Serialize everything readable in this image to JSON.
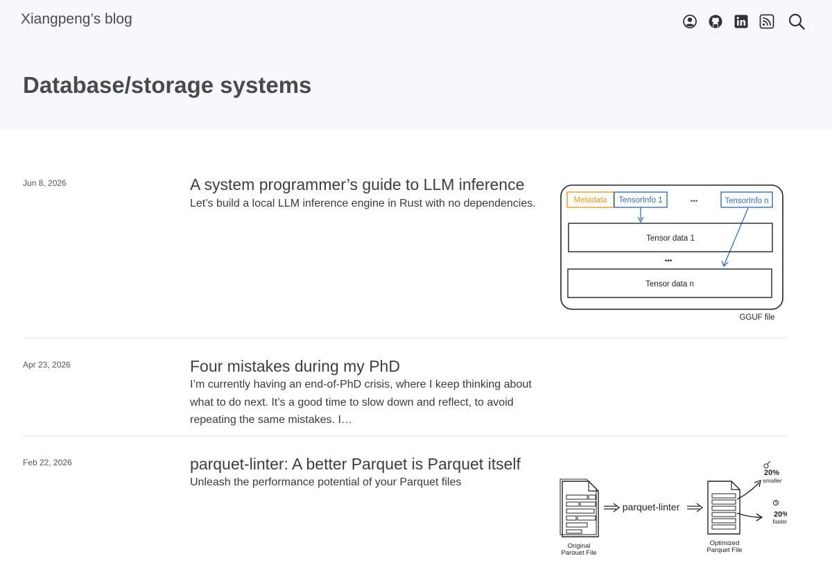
{
  "site": {
    "title": "Xiangpeng’s blog"
  },
  "header": {
    "icons": [
      "person-circle-icon",
      "github-icon",
      "linkedin-icon",
      "rss-icon",
      "search-icon"
    ]
  },
  "page": {
    "title": "Database/storage systems"
  },
  "posts": [
    {
      "date": "Jun 8, 2026",
      "title": "A system programmer’s guide to LLM inference",
      "description": "Let’s build a local LLM inference engine in Rust with no dependencies.",
      "thumbnail": {
        "metadata": "Metadata",
        "tensorinfo_1": "TensorInfo 1",
        "ellipsis": "•••",
        "tensorinfo_n": "TensorInfo n",
        "tensor_data_1": "Tensor data 1",
        "tensor_data_n": "Tensor data n",
        "caption": "GGUF file"
      }
    },
    {
      "date": "Apr 23, 2026",
      "title": "Four mistakes during my PhD",
      "description": "I’m currently having an end-of-PhD crisis, where I keep thinking about what to do next. It’s a good time to slow down and reflect, to avoid repeating the same mistakes. I…"
    },
    {
      "date": "Feb 22, 2026",
      "title": "parquet-linter: A better Parquet is Parquet itself",
      "description": "Unleash the performance potential of your Parquet files",
      "thumbnail": {
        "tool": "parquet-linter",
        "original_line1": "Original",
        "original_line2": "Parquet File",
        "optimized_line1": "Optimized",
        "optimized_line2": "Parquet File",
        "smaller_pct": "20%",
        "smaller_label": "smaller",
        "faster_pct": "20%",
        "faster_label": "faster"
      }
    }
  ],
  "colors": {
    "header_bg": "#f7f8fa",
    "metadata": "#e69b1a",
    "tensorinfo": "#2f6fb4",
    "text": "#3d3d3d"
  }
}
